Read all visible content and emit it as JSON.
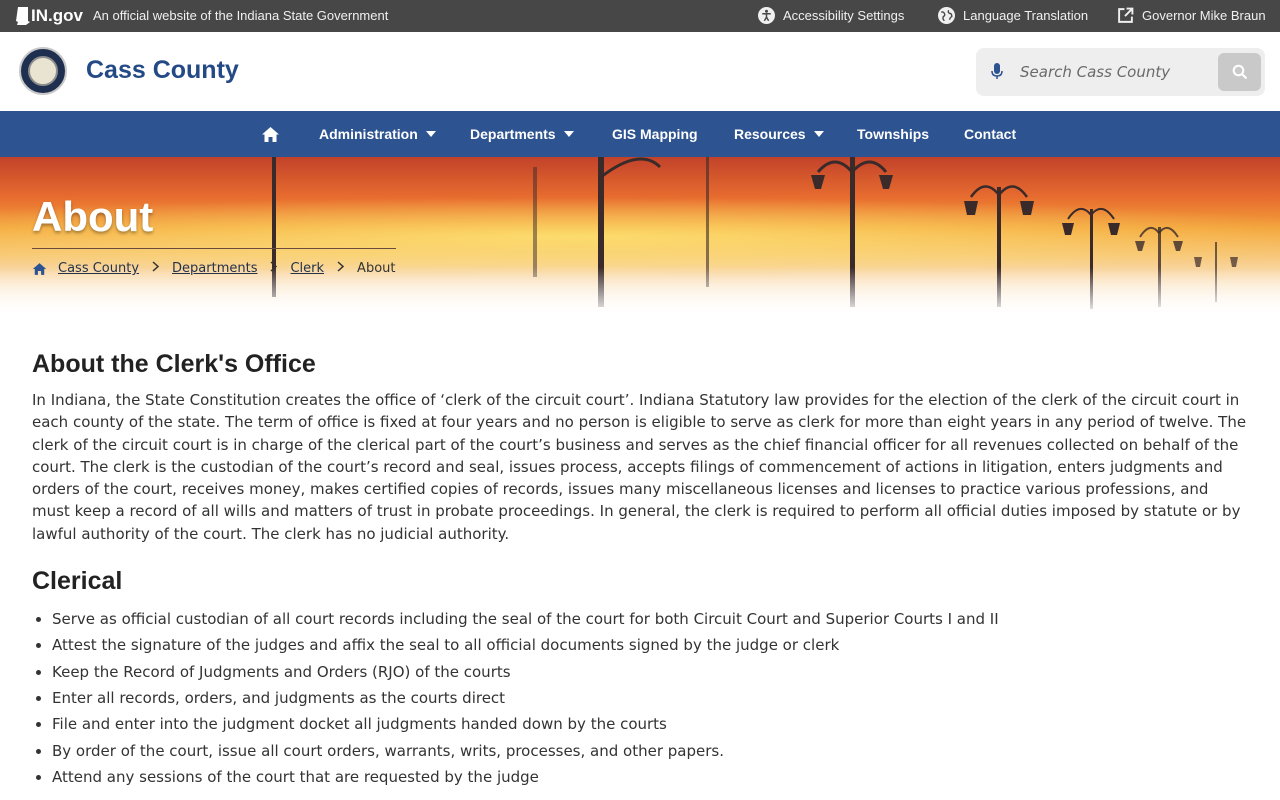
{
  "statebar": {
    "logo": "IN.gov",
    "official": "An official website of the Indiana State Government",
    "links": [
      {
        "label": "Accessibility Settings",
        "icon": "accessibility-icon"
      },
      {
        "label": "Language Translation",
        "icon": "globe-icon"
      },
      {
        "label": "Governor Mike Braun",
        "icon": "external-link-icon"
      }
    ]
  },
  "header": {
    "title": "Cass County",
    "search": {
      "placeholder": "Search Cass County",
      "value": ""
    }
  },
  "nav": {
    "items": [
      {
        "label": "",
        "icon": "home-icon"
      },
      {
        "label": "Administration",
        "dropdown": true
      },
      {
        "label": "Departments",
        "dropdown": true
      },
      {
        "label": "GIS Mapping",
        "dropdown": false
      },
      {
        "label": "Resources",
        "dropdown": true
      },
      {
        "label": "Townships",
        "dropdown": false
      },
      {
        "label": "Contact",
        "dropdown": false
      }
    ]
  },
  "hero": {
    "title": "About",
    "breadcrumb": [
      "Cass County",
      "Departments",
      "Clerk",
      "About"
    ]
  },
  "main": {
    "heading": "About the Clerk's Office",
    "intro": "In Indiana, the State Constitution creates the office of ‘clerk of the circuit court’. Indiana Statutory law provides for the election of the clerk of the circuit court in each county of the state. The term of office is fixed at four years and no person is eligible to serve as clerk for more than eight years in any period of twelve. The clerk of the circuit court is in charge of the clerical part of the court’s business and serves as the chief financial officer for all revenues collected on behalf of the court. The clerk is the custodian of the court’s record and seal, issues process, accepts filings of commencement of actions in litigation, enters judgments and orders of the court, receives money, makes certified copies of records, issues many miscellaneous licenses and licenses to practice various professions, and must keep a record of all wills and matters of trust in probate proceedings. In general, the clerk is required to perform all official duties imposed by statute or by lawful authority of the court. The clerk has no judicial authority.",
    "clerical_heading": "Clerical",
    "clerical_items": [
      "Serve as official custodian of all court records including the seal of the court for both Circuit Court and Superior Courts I and II",
      "Attest the signature of the judges and affix the seal to all official documents signed by the judge or clerk",
      "Keep the Record of Judgments and Orders (RJO) of the courts",
      "Enter all records, orders, and judgments as the courts direct",
      "File and enter into the judgment docket all judgments handed down by the courts",
      "By order of the court, issue all court orders, warrants, writs, processes, and other papers.",
      "Attend any sessions of the court that are requested by the judge"
    ]
  },
  "colors": {
    "statebar": "#474747",
    "nav": "#2d5391",
    "title_blue": "#244a86"
  }
}
